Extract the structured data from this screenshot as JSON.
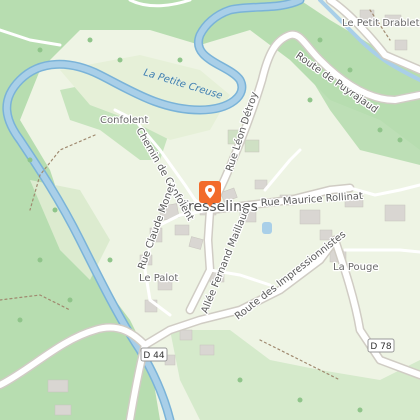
{
  "map": {
    "town": "Fresselines",
    "places": {
      "confolent": "Confolent",
      "le_petit_drablet": "Le Petit Drablet",
      "le_palot": "Le Palot",
      "la_pouge": "La Pouge"
    },
    "river": "La Petite Creuse",
    "roads": {
      "route_de_puyrajaud": "Route de Puyrajaud",
      "rue_leon_detroy": "Rue Léon Détroy",
      "chemin_de_confolent": "Chemin de Confolent",
      "rue_maurice_rollinat": "Rue Maurice Rollinat",
      "rue_claude_monet": "Rue Claude Monet",
      "allee_fernand_maillaud": "Allée Fernand Maillaud",
      "route_des_impressionnistes": "Route des Impressionnistes"
    },
    "shields": {
      "d44": "D 44",
      "d78": "D 78"
    },
    "marker_icon": "map-pin-icon",
    "colors": {
      "background": "#eef4e4",
      "forest": "#b7ddb0",
      "water": "#a9cfe8",
      "road": "#ffffff",
      "building": "#d9d6d2",
      "marker": "#f26b2b"
    }
  }
}
